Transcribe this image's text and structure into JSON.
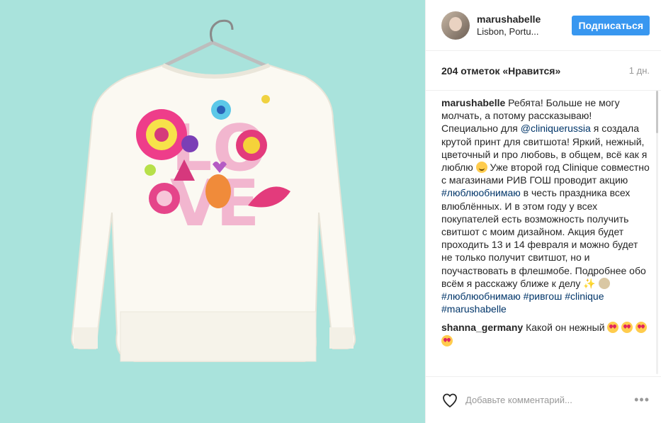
{
  "header": {
    "username": "marushabelle",
    "location": "Lisbon, Portu...",
    "follow_label": "Подписаться"
  },
  "meta": {
    "likes": "204 отметок «Нравится»",
    "date": "1 дн."
  },
  "caption": {
    "username": "marushabelle",
    "text_1": "Ребята! Больше не могу молчать, а потому рассказываю! Специально для",
    "mention": "@cliniquerussia",
    "text_2": "я создала крутой принт для свитшота! Яркий, нежный, цветочный и про любовь, в общем, всё как я люблю",
    "text_3": "Уже второй год Clinique совместно с магазинами РИВ ГОШ проводит акцию",
    "hashtag_1": "#люблюобнимаю",
    "text_4": "в честь праздника всех влюблённых. И в этом году у всех покупателей есть возможность получить свитшот с моим дизайном. Акция будет проходить 13 и 14 февраля и можно будет не только получит свитшот, но и поучаствовать в флешмобе. Подробнее обо всём я расскажу ближе к делу",
    "hashtag_2": "#люблюобнимаю",
    "hashtag_3": "#ривгош",
    "hashtag_4": "#clinique",
    "hashtag_5": "#marushabelle"
  },
  "comments": [
    {
      "username": "shanna_germany",
      "text": "Какой он нежный"
    }
  ],
  "footer": {
    "placeholder": "Добавьте комментарий...",
    "more": "•••"
  },
  "colors": {
    "accent": "#3897f0",
    "link": "#003569",
    "photo_bg": "#a9e3dc"
  },
  "icons": {
    "like": "heart-outline-icon",
    "more": "ellipsis-icon"
  }
}
